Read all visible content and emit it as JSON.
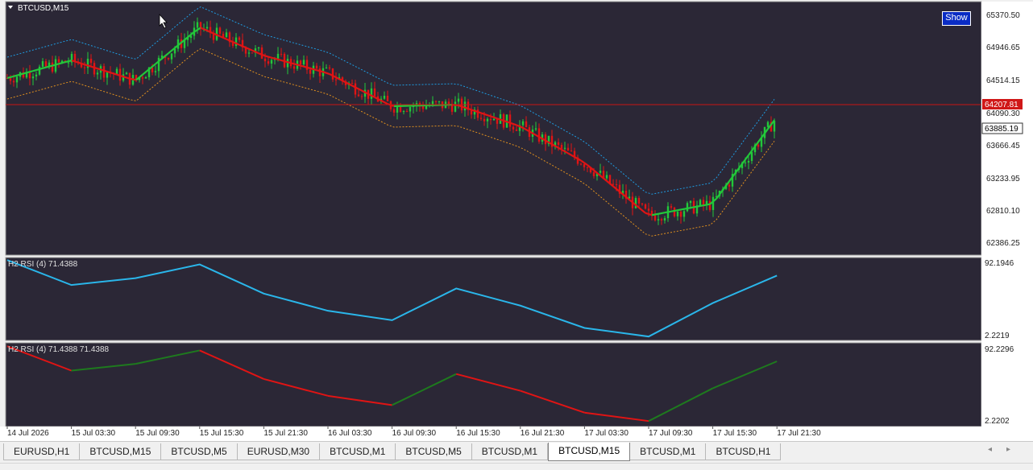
{
  "main": {
    "symbol_title": "BTCUSD,M15",
    "current_price": "64207.81",
    "marker_price": "63885.19",
    "show_button": "Show",
    "price_ticks": [
      "65370.50",
      "64946.65",
      "64514.15",
      "64090.30",
      "63666.45",
      "63233.95",
      "62810.10",
      "62386.25"
    ],
    "colors": {
      "background": "#2b2736",
      "up": "#22c83a",
      "down": "#e01414",
      "band": "#1e9be0",
      "lower_band": "#e0901e",
      "price_line": "#c81414"
    }
  },
  "rsi1": {
    "label": "H2 RSI (4) 71.4388",
    "top_tick": "92.1946",
    "bottom_tick": "2.2219",
    "line_color": "#2ab6ea"
  },
  "rsi2": {
    "label": "H2 RSI (4) 71.4388 71.4388",
    "top_tick": "92.2296",
    "bottom_tick": "2.2202"
  },
  "time_axis": [
    "14 Jul 2026",
    "15 Jul 03:30",
    "15 Jul 09:30",
    "15 Jul 15:30",
    "15 Jul 21:30",
    "16 Jul 03:30",
    "16 Jul 09:30",
    "16 Jul 15:30",
    "16 Jul 21:30",
    "17 Jul 03:30",
    "17 Jul 09:30",
    "17 Jul 15:30",
    "17 Jul 21:30"
  ],
  "tabs": [
    {
      "label": "EURUSD,H1",
      "active": false
    },
    {
      "label": "BTCUSD,M15",
      "active": false
    },
    {
      "label": "BTCUSD,M5",
      "active": false
    },
    {
      "label": "EURUSD,M30",
      "active": false
    },
    {
      "label": "BTCUSD,M1",
      "active": false
    },
    {
      "label": "BTCUSD,M5",
      "active": false
    },
    {
      "label": "BTCUSD,M1",
      "active": false
    },
    {
      "label": "BTCUSD,M15",
      "active": true
    },
    {
      "label": "BTCUSD,M1",
      "active": false
    },
    {
      "label": "BTCUSD,H1",
      "active": false
    }
  ],
  "chart_data": [
    {
      "type": "line",
      "title": "BTCUSD,M15",
      "x": [
        "14 Jul 2026",
        "15 Jul 03:30",
        "15 Jul 09:30",
        "15 Jul 15:30",
        "15 Jul 21:30",
        "16 Jul 03:30",
        "16 Jul 09:30",
        "16 Jul 15:30",
        "16 Jul 21:30",
        "17 Jul 03:30",
        "17 Jul 09:30",
        "17 Jul 15:30",
        "17 Jul 21:30"
      ],
      "series": [
        {
          "values": [
            64500,
            64720,
            64470,
            65130,
            64780,
            64560,
            64150,
            64170,
            63900,
            63450,
            62790,
            62940,
            64020
          ]
        }
      ],
      "ylim": [
        62300,
        65450
      ],
      "grid": false
    },
    {
      "type": "line",
      "title": "H2 RSI (4) 71.4388",
      "x": [
        "14 Jul 2026",
        "15 Jul 03:30",
        "15 Jul 09:30",
        "15 Jul 15:30",
        "15 Jul 21:30",
        "16 Jul 03:30",
        "16 Jul 09:30",
        "16 Jul 15:30",
        "16 Jul 21:30",
        "17 Jul 03:30",
        "17 Jul 09:30",
        "17 Jul 15:30",
        "17 Jul 21:30"
      ],
      "series": [
        {
          "values": [
            92,
            63,
            71,
            87,
            53,
            33,
            22,
            59,
            39,
            13,
            3,
            42,
            74
          ]
        }
      ],
      "ylim": [
        2.2219,
        92.1946
      ]
    }
  ]
}
